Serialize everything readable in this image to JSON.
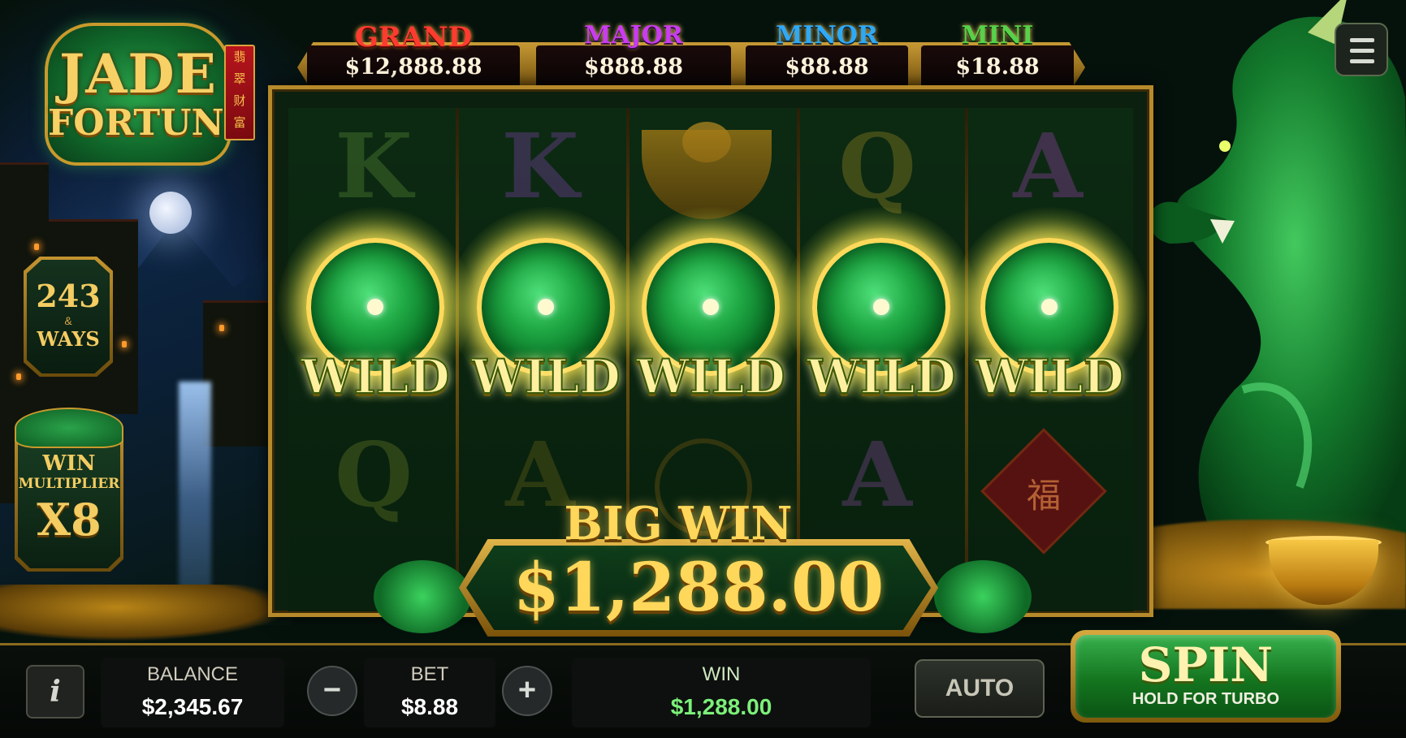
{
  "logo": {
    "line1": "JADE",
    "line2": "FORTUNE",
    "tag_chars": [
      "翡",
      "翠",
      "财",
      "富"
    ]
  },
  "ways": {
    "number": "243",
    "amp": "&",
    "label": "WAYS"
  },
  "multiplier": {
    "line1": "WIN",
    "line2": "MULTIPLIER",
    "value": "X8"
  },
  "jackpots": [
    {
      "name": "GRAND",
      "value": "$12,888.88",
      "color": "#ff3b30"
    },
    {
      "name": "MAJOR",
      "value": "$888.88",
      "color": "#c93cf0"
    },
    {
      "name": "MINOR",
      "value": "$88.88",
      "color": "#2ea9f5"
    },
    {
      "name": "MINI",
      "value": "$18.88",
      "color": "#57d14a"
    }
  ],
  "menu": {
    "icon": "hamburger-icon"
  },
  "reels": {
    "top_row": [
      "K",
      "K",
      "gold-ingot-icon",
      "Q",
      "A"
    ],
    "middle_row": [
      "WILD",
      "WILD",
      "WILD",
      "WILD",
      "WILD"
    ],
    "bottom_row": [
      "Q",
      "A",
      "coin-icon",
      "A",
      "fu-lantern-icon"
    ],
    "fu_char": "福"
  },
  "big_win": {
    "title": "BIG WIN",
    "amount": "$1,288.00"
  },
  "bottom_bar": {
    "info_icon": "i",
    "balance_label": "BALANCE",
    "balance_value": "$2,345.67",
    "minus": "−",
    "bet_label": "BET",
    "bet_value": "$8.88",
    "plus": "+",
    "win_label": "WIN",
    "win_value": "$1,288.00",
    "win_color": "#7cf07a",
    "auto_label": "AUTO",
    "spin_label": "SPIN",
    "spin_sub": "HOLD FOR TURBO"
  }
}
